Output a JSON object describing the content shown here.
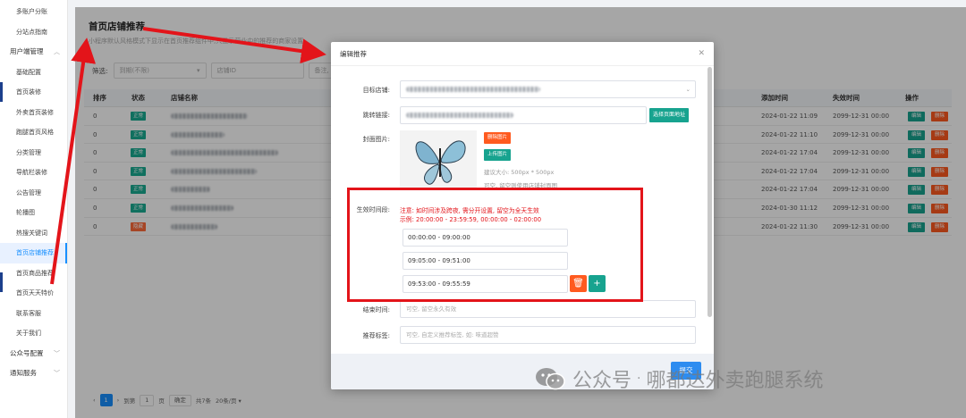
{
  "sidebar": {
    "items": [
      {
        "label": "多账户分账",
        "type": "item"
      },
      {
        "label": "分站点指南",
        "type": "item"
      },
      {
        "label": "用户端管理",
        "type": "group"
      },
      {
        "label": "基础配置",
        "type": "item"
      },
      {
        "label": "首页装修",
        "type": "item"
      },
      {
        "label": "外卖首页装修",
        "type": "item"
      },
      {
        "label": "跑腿首页风格",
        "type": "item"
      },
      {
        "label": "分类管理",
        "type": "item"
      },
      {
        "label": "导航栏装修",
        "type": "item"
      },
      {
        "label": "公告管理",
        "type": "item"
      },
      {
        "label": "轮播图",
        "type": "item"
      },
      {
        "label": "热搜关键词",
        "type": "item"
      },
      {
        "label": "首页店铺推荐",
        "type": "item",
        "active": true
      },
      {
        "label": "首页商品推荐",
        "type": "item"
      },
      {
        "label": "首页天天特价",
        "type": "item"
      },
      {
        "label": "联系客服",
        "type": "item"
      },
      {
        "label": "关于我们",
        "type": "item"
      },
      {
        "label": "公众号配置",
        "type": "group"
      },
      {
        "label": "通知服务",
        "type": "group"
      }
    ]
  },
  "page": {
    "title": "首页店铺推荐",
    "description": "小程序默认风格模式下显示在首页推荐组件中,只显示营业中的推荐的商家设置"
  },
  "filter": {
    "label": "筛选:",
    "status_select": "到期(不限)",
    "store_id_placeholder": "店铺ID",
    "remark_placeholder": "备注, 支持模糊"
  },
  "table": {
    "headers": {
      "sort": "排序",
      "status": "状态",
      "store_name": "店铺名称",
      "added_time": "添加时间",
      "expire_time": "失效时间",
      "actions": "操作"
    },
    "rows": [
      {
        "sort": "0",
        "status": "正常",
        "status_type": "ok",
        "added": "2024-01-22 11:09",
        "expire": "2099-12-31 00:00"
      },
      {
        "sort": "0",
        "status": "正常",
        "status_type": "ok",
        "added": "2024-01-22 11:10",
        "expire": "2099-12-31 00:00"
      },
      {
        "sort": "0",
        "status": "正常",
        "status_type": "ok",
        "added": "2024-01-22 17:04",
        "expire": "2099-12-31 00:00"
      },
      {
        "sort": "0",
        "status": "正常",
        "status_type": "ok",
        "added": "2024-01-22 17:04",
        "expire": "2099-12-31 00:00"
      },
      {
        "sort": "0",
        "status": "正常",
        "status_type": "ok",
        "added": "2024-01-22 17:04",
        "expire": "2099-12-31 00:00"
      },
      {
        "sort": "0",
        "status": "正常",
        "status_type": "ok",
        "added": "2024-01-30 11:12",
        "expire": "2099-12-31 00:00"
      },
      {
        "sort": "0",
        "status": "隐藏",
        "status_type": "hide",
        "added": "2024-01-22 11:30",
        "expire": "2099-12-31 00:00"
      }
    ],
    "edit_label": "编辑",
    "delete_label": "删除"
  },
  "pagination": {
    "current_page": "1",
    "goto_label": "到第",
    "page_input": "1",
    "page_unit": "页",
    "confirm": "确定",
    "total": "共7条",
    "page_size": "20条/页"
  },
  "modal": {
    "title": "编辑推荐",
    "target_store_label": "目标店铺:",
    "jump_link_label": "跳转链接:",
    "select_page_button": "选择页面地址",
    "cover_label": "封面图片:",
    "delete_image_button": "删除图片",
    "upload_image_button": "上传图片",
    "size_hint": "建议大小: 500px * 500px",
    "optional_hint": "可空, 留空则使用店铺封面图",
    "time_label": "生效时间段:",
    "notice_line1": "注意: 如时间涉及跨夜, 需分开设置, 留空为全天生效",
    "notice_line2": "示例: 20:00:00 - 23:59:59, 00:00:00 - 02:00:00",
    "time_ranges": [
      "00:00:00 - 09:00:00",
      "09:05:00 - 09:51:00",
      "09:53:00 - 09:55:59"
    ],
    "end_time_label": "结束时间:",
    "end_time_placeholder": "可空, 留空永久有效",
    "tags_label": "推荐标签:",
    "tags_placeholder": "可空, 自定义推荐标签, 如: 味道超赞",
    "submit": "提交"
  },
  "watermark": {
    "text": "公众号",
    "dot": "·",
    "brand": "哪都达外卖跑腿系统"
  },
  "colors": {
    "primary": "#1890ff",
    "teal": "#17a38f",
    "orange": "#ff5a1f",
    "annotation_red": "#e3141a"
  }
}
